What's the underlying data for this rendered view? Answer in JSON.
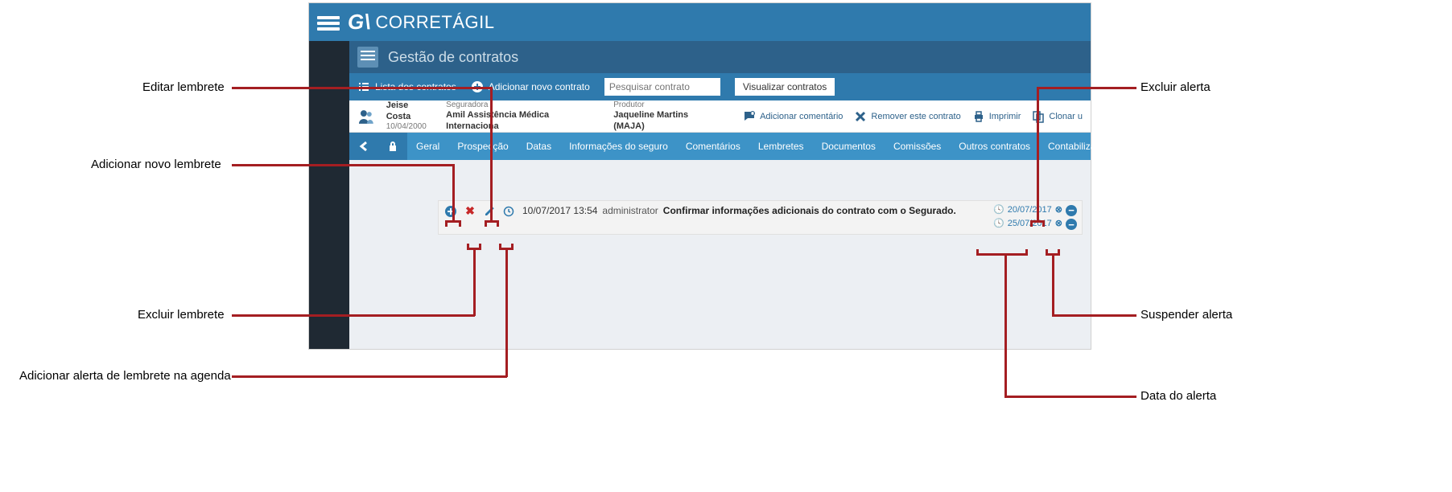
{
  "brand": "CORRETÁGIL",
  "page_title": "Gestão de contratos",
  "toolbar": {
    "list_label": "Lista dos contratos",
    "add_label": "Adicionar novo contrato",
    "search_placeholder": "Pesquisar contrato",
    "view_label": "Visualizar contratos"
  },
  "context": {
    "client_name": "Jeise Costa",
    "client_date": "10/04/2000",
    "insurer_label": "Seguradora",
    "insurer_value": "Amil Assistência Médica Internaciona",
    "producer_label": "Produtor",
    "producer_value": "Jaqueline Martins (MAJA)",
    "add_comment": "Adicionar comentário",
    "remove": "Remover este contrato",
    "print": "Imprimir",
    "clone": "Clonar u"
  },
  "tabs": [
    "Geral",
    "Prospecção",
    "Datas",
    "Informações do seguro",
    "Comentários",
    "Lembretes",
    "Documentos",
    "Comissões",
    "Outros contratos",
    "Contabilizaç"
  ],
  "reminder": {
    "datetime": "10/07/2017 13:54",
    "user": "administrator",
    "description": "Confirmar informações adicionais do contrato com o Segurado.",
    "alerts": [
      "20/07/2017",
      "25/07/2017"
    ]
  },
  "annotations": {
    "edit": "Editar lembrete",
    "add_new": "Adicionar novo lembrete",
    "delete": "Excluir lembrete",
    "add_alert": "Adicionar alerta de lembrete na agenda",
    "exclude_alert": "Excluir alerta",
    "suspend_alert": "Suspender alerta",
    "alert_date": "Data do alerta"
  }
}
